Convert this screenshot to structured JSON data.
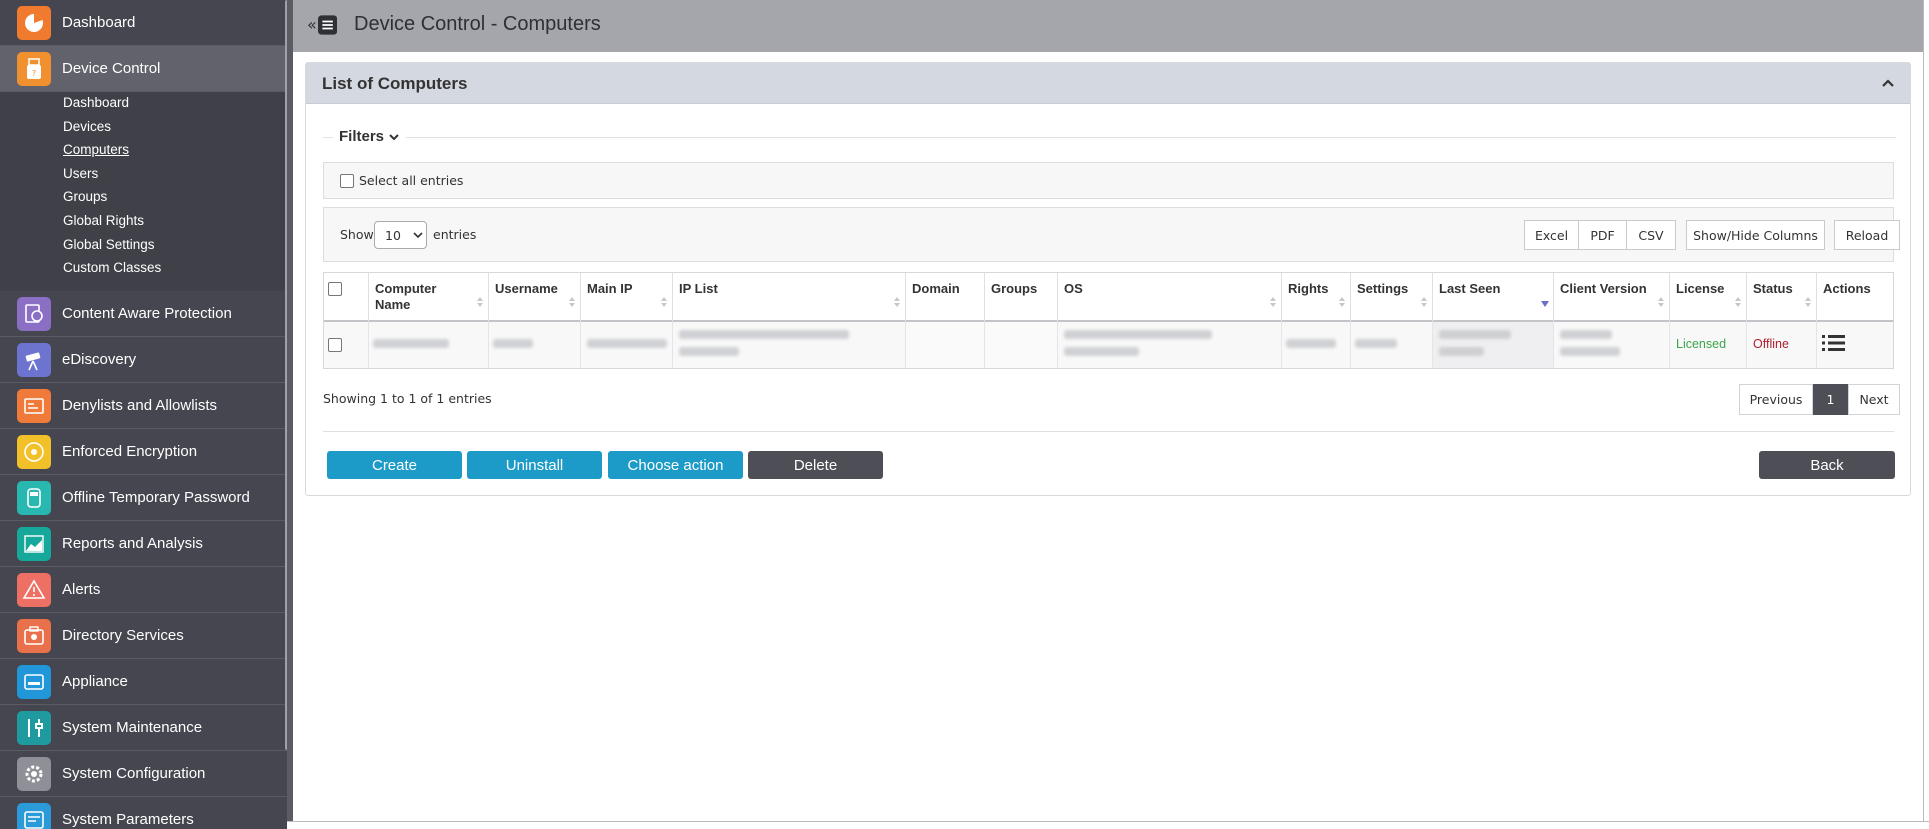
{
  "colors": {
    "sidebar_bg": "#45464f",
    "accent_blue": "#1d9bc8",
    "dark_button": "#4d4e56",
    "licensed_green": "#3ca54a",
    "offline_red": "#b02030"
  },
  "header": {
    "title": "Device Control - Computers"
  },
  "sidebar": {
    "items": [
      {
        "label": "Dashboard",
        "icon": "dashboard-icon",
        "color": "#f07a2e"
      },
      {
        "label": "Device Control",
        "icon": "usb-drive-icon",
        "color": "#f0902e"
      },
      {
        "label": "Content Aware Protection",
        "icon": "content-aware-icon",
        "color": "#8a6fc4"
      },
      {
        "label": "eDiscovery",
        "icon": "telescope-icon",
        "color": "#6c74d0"
      },
      {
        "label": "Denylists and Allowlists",
        "icon": "list-card-icon",
        "color": "#f07a3a"
      },
      {
        "label": "Enforced Encryption",
        "icon": "disc-lock-icon",
        "color": "#f2c12a"
      },
      {
        "label": "Offline Temporary Password",
        "icon": "password-device-icon",
        "color": "#28b8b0"
      },
      {
        "label": "Reports and Analysis",
        "icon": "chart-icon",
        "color": "#16a89a"
      },
      {
        "label": "Alerts",
        "icon": "warning-icon",
        "color": "#ee6f64"
      },
      {
        "label": "Directory Services",
        "icon": "directory-icon",
        "color": "#e8704a"
      },
      {
        "label": "Appliance",
        "icon": "appliance-icon",
        "color": "#2196d8"
      },
      {
        "label": "System Maintenance",
        "icon": "tools-icon",
        "color": "#1f9a9e"
      },
      {
        "label": "System Configuration",
        "icon": "gear-icon",
        "color": "#8f9097"
      },
      {
        "label": "System Parameters",
        "icon": "parameters-icon",
        "color": "#2a9ad8"
      }
    ],
    "submenu": [
      "Dashboard",
      "Devices",
      "Computers",
      "Users",
      "Groups",
      "Global Rights",
      "Global Settings",
      "Custom Classes"
    ]
  },
  "panel": {
    "title": "List of Computers",
    "filters_label": "Filters"
  },
  "select_all": {
    "label": "Select all entries"
  },
  "toolbar": {
    "show_label": "Show",
    "page_size": "10",
    "entries_label": "entries",
    "excel": "Excel",
    "pdf": "PDF",
    "csv": "CSV",
    "show_hide": "Show/Hide Columns",
    "reload": "Reload"
  },
  "table": {
    "columns": [
      "Computer Name",
      "Username",
      "Main IP",
      "IP List",
      "Domain",
      "Groups",
      "OS",
      "Rights",
      "Settings",
      "Last Seen",
      "Client Version",
      "License",
      "Status",
      "Actions"
    ],
    "row": {
      "license": "Licensed",
      "status": "Offline"
    }
  },
  "footer": {
    "showing": "Showing 1 to 1 of 1 entries",
    "previous": "Previous",
    "page": "1",
    "next": "Next"
  },
  "actions": {
    "create": "Create",
    "uninstall": "Uninstall",
    "choose_action": "Choose action",
    "delete": "Delete",
    "back": "Back"
  }
}
